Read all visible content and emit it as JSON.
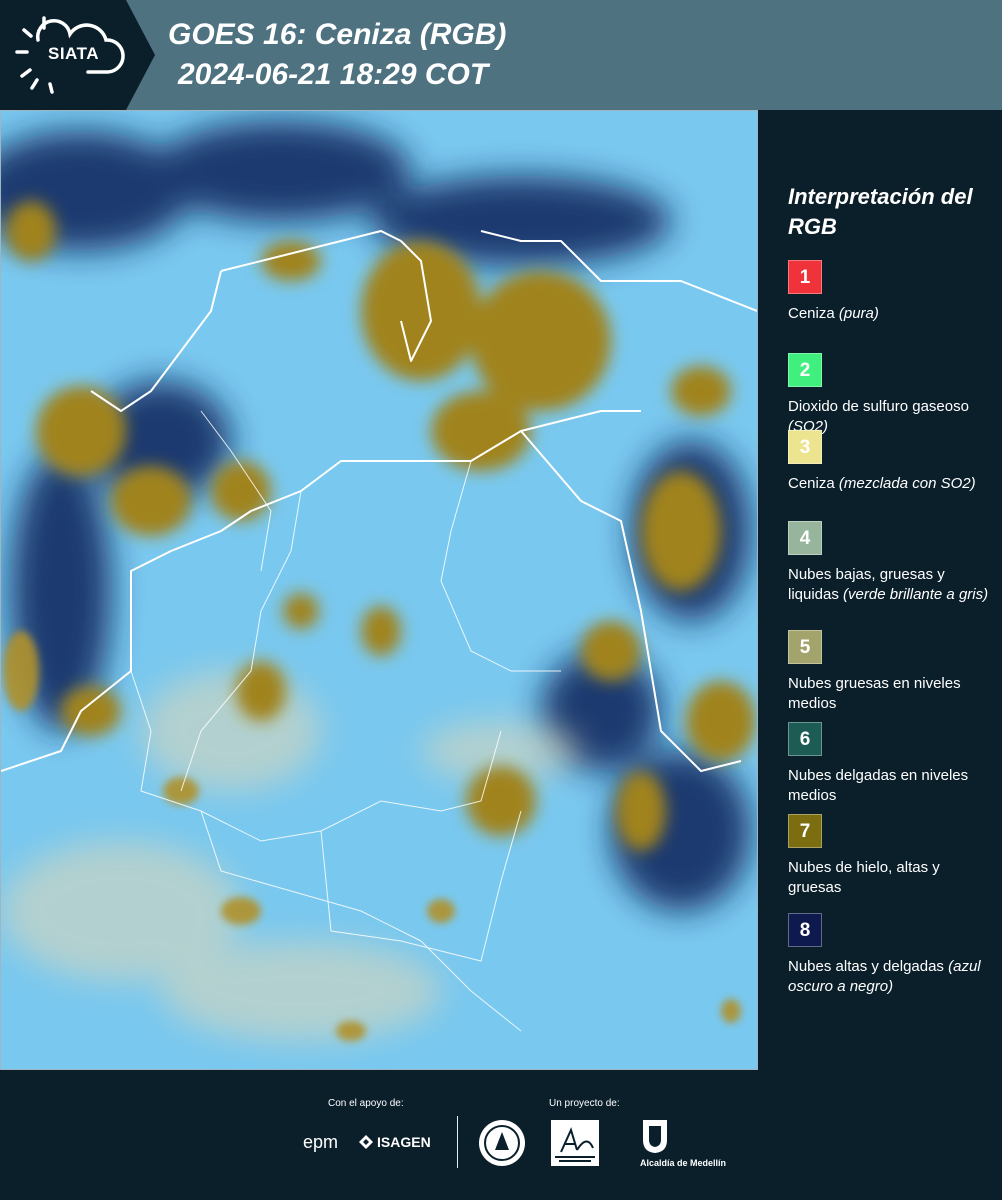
{
  "header": {
    "logo": "SIATA",
    "title": "GOES 16: Ceniza (RGB)",
    "datetime": "2024-06-21 18:29 COT"
  },
  "legend": {
    "title": "Interpretación del RGB",
    "items": [
      {
        "number": "1",
        "label": "Ceniza",
        "note": "(pura)",
        "color": "#f0333a"
      },
      {
        "number": "2",
        "label": "Dioxido de sulfuro gaseoso",
        "note": "(SO2)",
        "color": "#3ff07e"
      },
      {
        "number": "3",
        "label": "Ceniza",
        "note": "(mezclada con SO2)",
        "color": "#ece48f"
      },
      {
        "number": "4",
        "label": "Nubes bajas, gruesas y liquidas",
        "note": "(verde brillante a gris)",
        "color": "#97b49d"
      },
      {
        "number": "5",
        "label": "Nubes gruesas en niveles medios",
        "note": "",
        "color": "#a3a46b"
      },
      {
        "number": "6",
        "label": "Nubes delgadas en niveles medios",
        "note": "",
        "color": "#1d5c55"
      },
      {
        "number": "7",
        "label": "Nubes de hielo, altas y gruesas",
        "note": "",
        "color": "#7b6d10"
      },
      {
        "number": "8",
        "label": "Nubes altas y delgadas",
        "note": "(azul oscuro a negro)",
        "color": "#0e1a4d"
      }
    ]
  },
  "footer": {
    "support_label": "Con el apoyo de:",
    "project_label": "Un proyecto de:",
    "sponsors": [
      "epm",
      "ISAGEN"
    ],
    "partners": [
      "Área Metropolitana Valle de Aburrá",
      "Alcaldía de Medellín"
    ]
  },
  "icons": {
    "logo": "sun-cloud-icon",
    "partner_seal": "seal-icon",
    "city_crest": "crest-icon"
  }
}
